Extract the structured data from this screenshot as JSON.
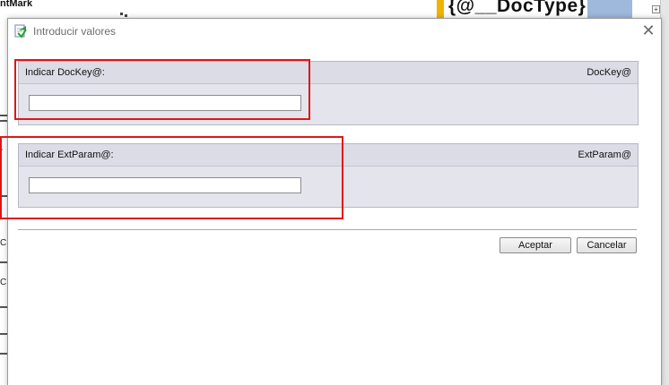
{
  "background": {
    "field_mark_text": "ntMark",
    "doctype_text": "{@__DocType}",
    "expand_symbol": "+",
    "left_letters": [
      "r",
      "C",
      "C"
    ]
  },
  "dialog": {
    "title": "Introducir valores",
    "close_glyph": "✕",
    "icon": "app-form-icon",
    "params": [
      {
        "label": "Indicar DocKey@:",
        "var_name": "DocKey@",
        "value": ""
      },
      {
        "label": "Indicar ExtParam@:",
        "var_name": "ExtParam@",
        "value": ""
      }
    ],
    "buttons": {
      "accept": "Aceptar",
      "cancel": "Cancelar"
    }
  },
  "colors": {
    "highlight": "#e01515",
    "panel_bg": "#e4e4ed",
    "doctype_accent": "#f0b400"
  }
}
